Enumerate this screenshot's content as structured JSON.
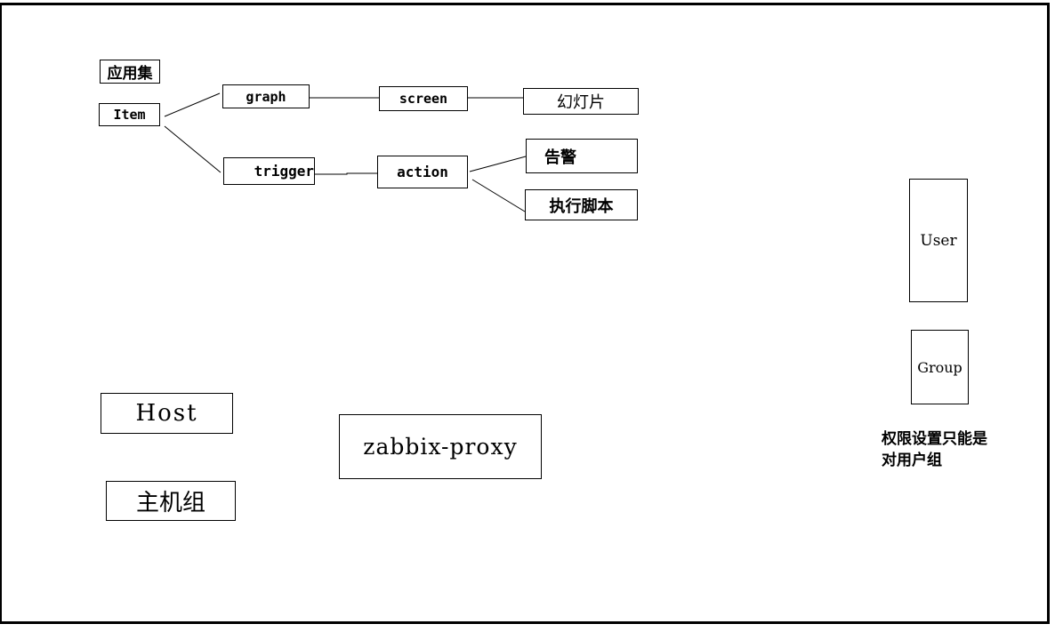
{
  "diagram": {
    "nodes": {
      "app_set": "应用集",
      "item": "Item",
      "graph": "graph",
      "trigger": "trigger",
      "screen": "screen",
      "slideshow": "幻灯片",
      "action": "action",
      "alert": "告警",
      "exec_script": "执行脚本",
      "user": "User",
      "group": "Group",
      "host": "Host",
      "host_group": "主机组",
      "zabbix_proxy": "zabbix-proxy"
    },
    "edges": [
      {
        "from": "item",
        "to": "graph"
      },
      {
        "from": "item",
        "to": "trigger"
      },
      {
        "from": "graph",
        "to": "screen"
      },
      {
        "from": "screen",
        "to": "slideshow"
      },
      {
        "from": "trigger",
        "to": "action"
      },
      {
        "from": "action",
        "to": "alert"
      },
      {
        "from": "action",
        "to": "exec_script"
      }
    ],
    "note_line1": "权限设置只能是",
    "note_line2": "对用户组"
  }
}
